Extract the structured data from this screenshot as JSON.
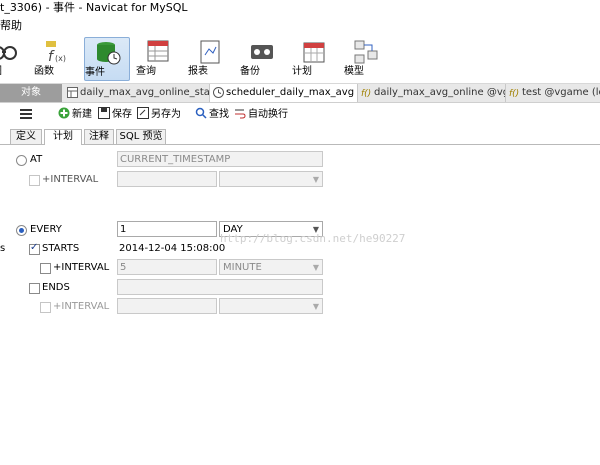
{
  "window": {
    "title": "t_3306) - 事件 - Navicat for MySQL"
  },
  "menu": {
    "help": "帮助"
  },
  "toolbar": [
    {
      "label": "视图",
      "icon": "view-icon"
    },
    {
      "label": "函数",
      "icon": "function-icon"
    },
    {
      "label": "事件",
      "icon": "event-icon",
      "active": true
    },
    {
      "label": "查询",
      "icon": "query-icon"
    },
    {
      "label": "报表",
      "icon": "report-icon"
    },
    {
      "label": "备份",
      "icon": "backup-icon"
    },
    {
      "label": "计划",
      "icon": "schedule-icon"
    },
    {
      "label": "模型",
      "icon": "model-icon"
    }
  ],
  "doc_tabs": {
    "objects": "对象",
    "tabs": [
      {
        "label": "daily_max_avg_online_statist...",
        "icon": "table-icon"
      },
      {
        "label": "scheduler_daily_max_avg @...",
        "icon": "event-icon",
        "active": true
      },
      {
        "label": "daily_max_avg_online @vga...",
        "icon": "function-icon"
      },
      {
        "label": "test @vgame (loc",
        "icon": "function-icon"
      }
    ]
  },
  "subtoolbar": {
    "new": "新建",
    "save": "保存",
    "save_as": "另存为",
    "find": "查找",
    "wrap": "自动换行"
  },
  "inner_tabs": [
    "定义",
    "计划",
    "注释",
    "SQL 预览"
  ],
  "form": {
    "at_label": "AT",
    "at_value": "CURRENT_TIMESTAMP",
    "at_interval_label": "+INTERVAL",
    "every_label": "EVERY",
    "every_value": "1",
    "every_unit": "DAY",
    "starts_label": "STARTS",
    "starts_value": "2014-12-04 15:08:00",
    "starts_interval_label": "+INTERVAL",
    "starts_interval_value": "5",
    "starts_interval_unit": "MINUTE",
    "ends_label": "ENDS",
    "ends_interval_label": "+INTERVAL"
  },
  "watermark": "http://blog.csdn.net/he90227",
  "left_edge": "s"
}
